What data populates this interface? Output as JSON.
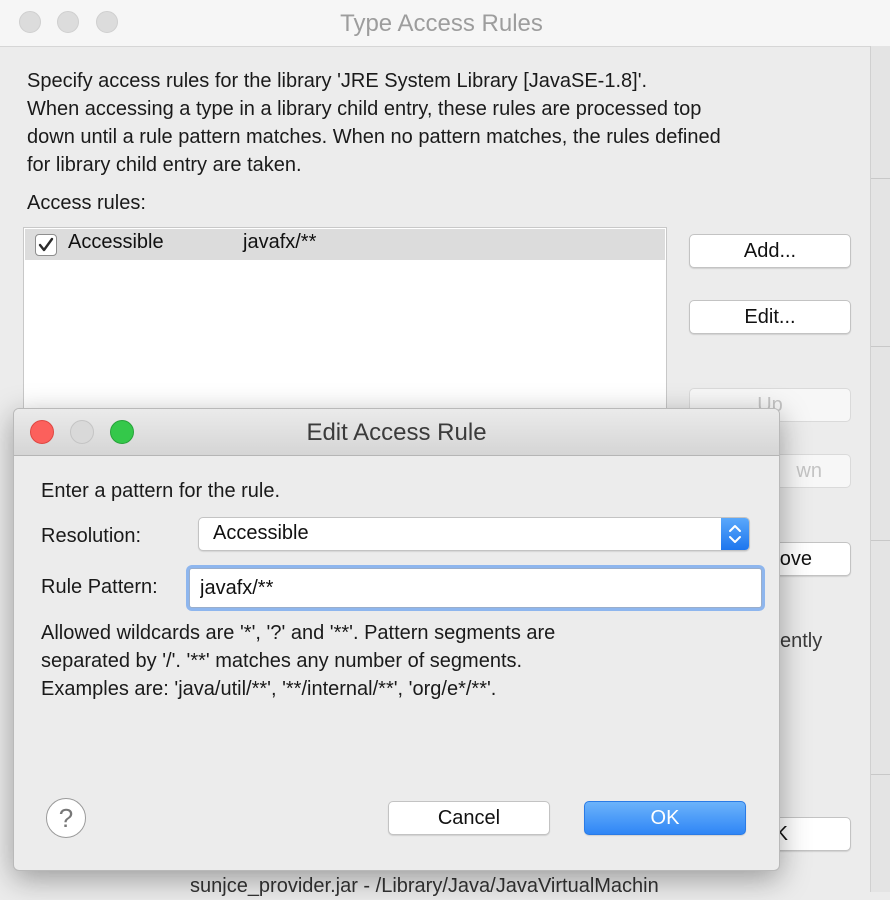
{
  "background_window": {
    "title": "Type Access Rules",
    "description_lines": [
      "Specify access rules for the library 'JRE System Library [JavaSE-1.8]'.",
      "When accessing a type in a library child entry, these rules are processed top",
      "down until a rule pattern matches. When no pattern matches, the rules defined",
      "for library child entry are taken."
    ],
    "access_rules_label": "Access rules:",
    "rules": [
      {
        "checked": true,
        "resolution": "Accessible",
        "pattern": "javafx/**"
      }
    ],
    "buttons": {
      "add": "Add...",
      "edit": "Edit...",
      "up": "Up",
      "down": "wn",
      "remove": "ove",
      "ok": "K"
    },
    "partial_text_right": "ently",
    "partial_text_bottom": "sunjce_provider.jar - /Library/Java/JavaVirtualMachin"
  },
  "dialog": {
    "title": "Edit Access Rule",
    "prompt": "Enter a pattern for the rule.",
    "resolution_label": "Resolution:",
    "resolution_value": "Accessible",
    "rule_pattern_label": "Rule Pattern:",
    "rule_pattern_value": "javafx/**",
    "help_lines": [
      "Allowed wildcards are '*', '?' and '**'. Pattern segments are",
      "separated by '/'. '**' matches any number of segments.",
      "Examples are: 'java/util/**', '**/internal/**', 'org/e*/**'."
    ],
    "help_icon": "?",
    "cancel_label": "Cancel",
    "ok_label": "OK"
  },
  "colors": {
    "close": "#fc605c",
    "maximize": "#34c84a",
    "accent": "#2f86f6"
  }
}
